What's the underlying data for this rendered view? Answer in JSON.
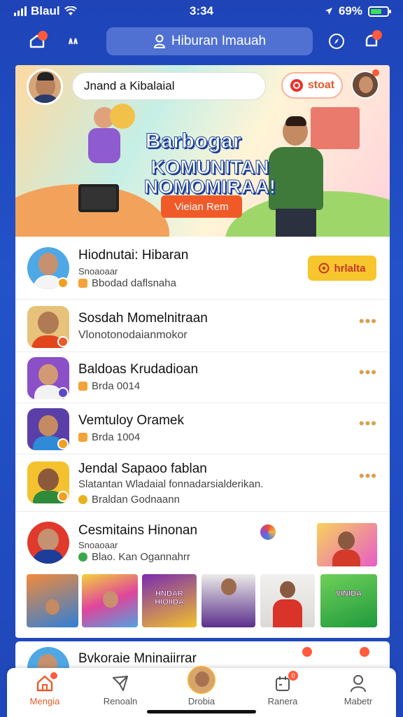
{
  "status_bar": {
    "carrier": "Blaul",
    "time": "3:34",
    "battery_label": "69%",
    "battery_level": 0.69
  },
  "header": {
    "search_label": "Hiburan Imauah"
  },
  "banner": {
    "input_value": "Jnand a Kibalaial",
    "start_label": "stoat",
    "title": "Barbogar",
    "subtitle": "KOMUNITAN NOMOMIRAA!",
    "cta_label": "Vieian Rem"
  },
  "rows": [
    {
      "title": "Hiodnutai: Hibaran",
      "sub": "Snoaoaar",
      "meta": "Bbodad daflsnaha",
      "action_label": "hrlalta"
    },
    {
      "title": "Sosdah Momelnitraan",
      "sub": "Vlonotonodaianmokor"
    },
    {
      "title": "Baldoas Krudadioan",
      "meta": "Brda 0014"
    },
    {
      "title": "Vemtuloy Oramek",
      "meta": "Brda 1004"
    },
    {
      "title": "Jendal Sapaoo fablan",
      "sub": "Slatantan Wladaial fonnadarsialderikan.",
      "meta": "Braldan Godnaann"
    },
    {
      "title": "Cesmitains Hinonan",
      "sub": "Snoaoaar",
      "meta": "Blao. Kan Ogannahrr"
    }
  ],
  "thumbnails": [
    {
      "caption": ""
    },
    {
      "caption": ""
    },
    {
      "caption": "HNDAR HIOIIDA"
    },
    {
      "caption": ""
    },
    {
      "caption": ""
    },
    {
      "caption": "VINIDA"
    }
  ],
  "peek": {
    "title": "Bvkoraie Mninaiirrar"
  },
  "nav": [
    {
      "label": "Mengia",
      "icon": "home-icon"
    },
    {
      "label": "Renoaln",
      "icon": "paper-plane-icon"
    },
    {
      "label": "Drobia",
      "icon": "profile-avatar-icon"
    },
    {
      "label": "Ranera",
      "icon": "calendar-icon",
      "badge": "0"
    },
    {
      "label": "Mabetr",
      "icon": "person-icon"
    }
  ],
  "colors": {
    "accent": "#e85b2a",
    "primary_blue": "#1f47b9",
    "yellow": "#f7c52c"
  }
}
